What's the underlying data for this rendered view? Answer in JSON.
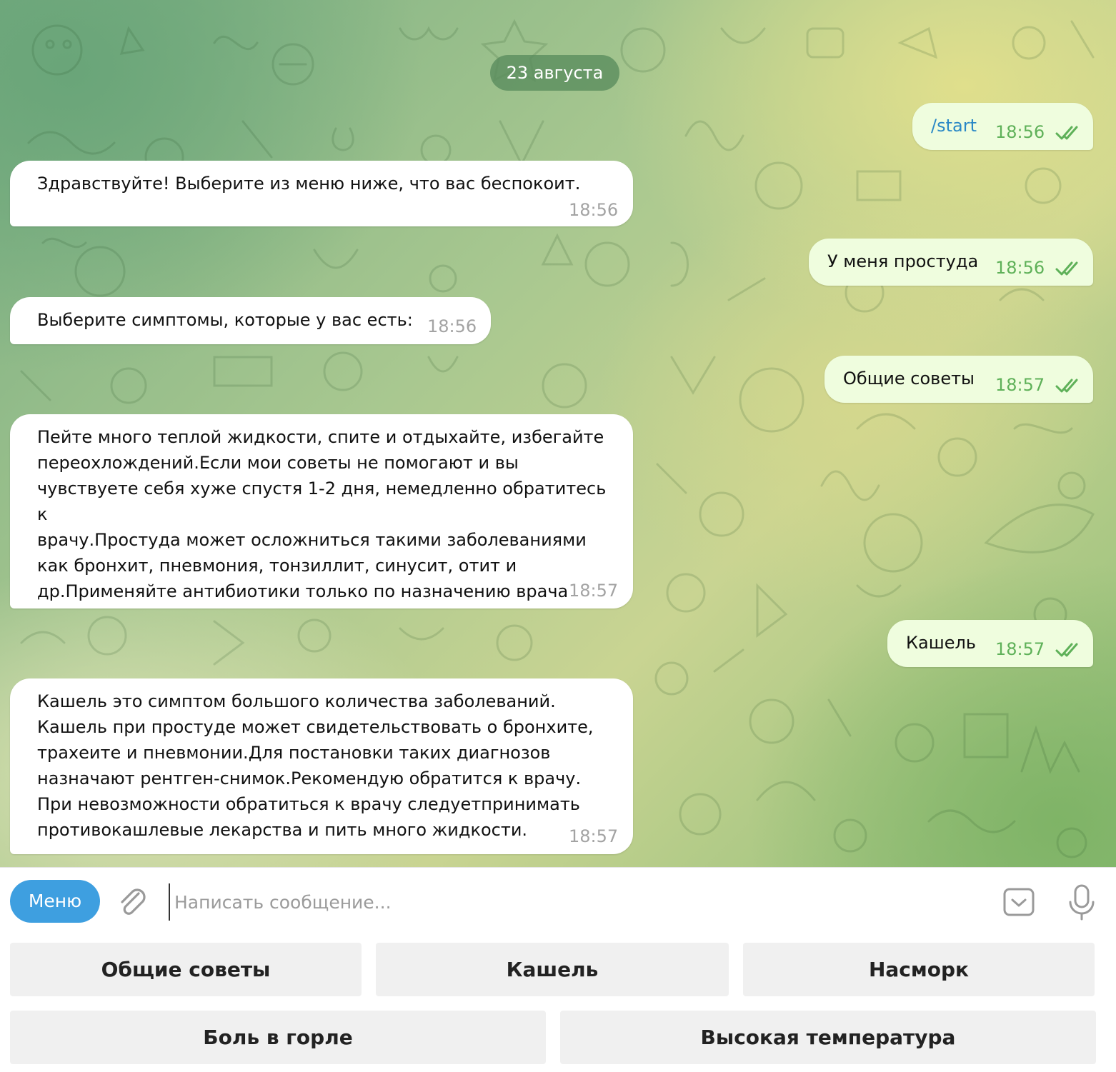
{
  "chat": {
    "date_label": "23 августа",
    "messages": [
      {
        "direction": "out",
        "text": "/start",
        "time": "18:56",
        "read": true
      },
      {
        "direction": "in",
        "text": "Здравствуйте! Выберите из меню ниже, что вас беспокоит.",
        "time": "18:56"
      },
      {
        "direction": "out",
        "text": "У меня простуда",
        "time": "18:56",
        "read": true
      },
      {
        "direction": "in",
        "text": "Выберите симптомы, которые у вас есть:",
        "time": "18:56"
      },
      {
        "direction": "out",
        "text": "Общие советы",
        "time": "18:57",
        "read": true
      },
      {
        "direction": "in",
        "text": "Пейте много теплой жидкости, спите и отдыхайте, избегайте\nпереохлождений.Если мои советы не помогают и вы\nчувствуете себя хуже спустя 1-2 дня, немедленно обратитесь к\nврачу.Простуда может осложниться такими заболеваниями\nкак бронхит, пневмония, тонзиллит, синусит, отит и\nдр.Применяйте антибиотики только по назначению врача",
        "time": "18:57"
      },
      {
        "direction": "out",
        "text": "Кашель",
        "time": "18:57",
        "read": true
      },
      {
        "direction": "in",
        "text": "Кашель это симптом большого количества заболеваний.\nКашель при простуде может свидетельствовать о бронхите,\nтрахеите и пневмонии.Для постановки таких диагнозов\nназначают рентген-снимок.Рекомендую обратится к врачу.\nПри невозможности обратиться к врачу следуетпринимать\nпротивокашлевые лекарства и пить много жидкости.",
        "time": "18:57"
      }
    ]
  },
  "composer": {
    "menu_label": "Меню",
    "placeholder": "Написать сообщение...",
    "attach_icon": "paperclip-icon",
    "keyboard_icon": "keyboard-toggle-icon",
    "mic_icon": "microphone-icon"
  },
  "reply_keyboard": {
    "rows": [
      [
        "Общие советы",
        "Кашель",
        "Насморк"
      ],
      [
        "Боль в горле",
        "Высокая температура"
      ]
    ]
  },
  "colors": {
    "accent": "#3e9fe0",
    "outgoing_bubble": "#effdde",
    "incoming_bubble": "#ffffff",
    "read_ticks": "#5fb159",
    "command_link": "#2a88c6"
  }
}
